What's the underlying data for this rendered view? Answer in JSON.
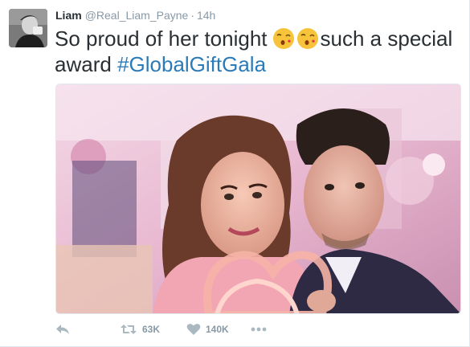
{
  "tweet": {
    "author": {
      "name": "Liam",
      "handle": "@Real_Liam_Payne",
      "separator": "·",
      "time": "14h"
    },
    "text_part1": "So proud of her tonight",
    "text_part2": "such a special award",
    "hashtag": "#GlobalGiftGala",
    "emojis": [
      "face-throwing-kiss-emoji",
      "face-throwing-kiss-emoji"
    ],
    "media": {
      "type": "photo",
      "icon": "photo-image"
    },
    "actions": {
      "retweet_count": "63K",
      "like_count": "140K"
    }
  },
  "colors": {
    "text": "#292f33",
    "muted": "#8899a6",
    "hashtag": "#2b7bb9",
    "icon": "#aab8c2",
    "border": "#e1e8ed"
  }
}
